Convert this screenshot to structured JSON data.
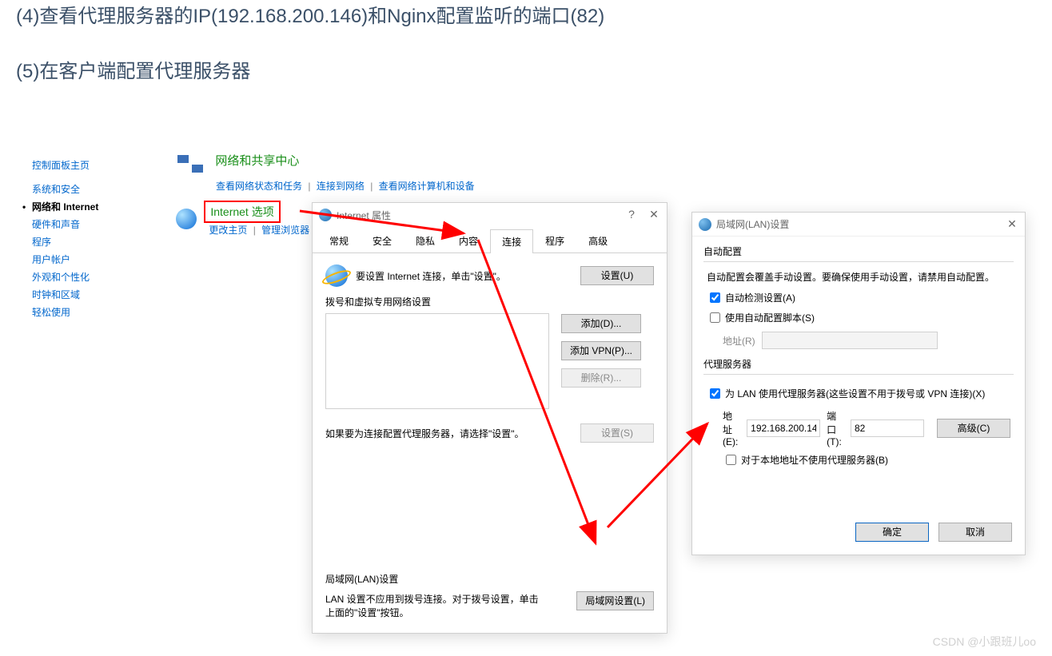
{
  "headings": {
    "line1": "(4)查看代理服务器的IP(192.168.200.146)和Nginx配置监听的端口(82)",
    "line2": "(5)在客户端配置代理服务器"
  },
  "control_panel": {
    "home": "控制面板主页",
    "sidebar": [
      "系统和安全",
      "网络和 Internet",
      "硬件和声音",
      "程序",
      "用户帐户",
      "外观和个性化",
      "时钟和区域",
      "轻松使用"
    ],
    "network_center_title": "网络和共享中心",
    "network_center_links": {
      "a": "查看网络状态和任务",
      "b": "连接到网络",
      "c": "查看网络计算机和设备"
    },
    "internet_options_label": "Internet 选项",
    "internet_options_sublinks": {
      "a": "更改主页",
      "b": "管理浏览器"
    }
  },
  "inet_dialog": {
    "title": "Internet 属性",
    "tabs": [
      "常规",
      "安全",
      "隐私",
      "内容",
      "连接",
      "程序",
      "高级"
    ],
    "instruction": "要设置 Internet 连接，单击\"设置\"。",
    "settings_btn": "设置(U)",
    "dial_legend": "拨号和虚拟专用网络设置",
    "btn_add": "添加(D)...",
    "btn_add_vpn": "添加 VPN(P)...",
    "btn_remove": "删除(R)...",
    "btn_dial_settings": "设置(S)",
    "proxy_hint": "如果要为连接配置代理服务器，请选择\"设置\"。",
    "lan_legend": "局域网(LAN)设置",
    "lan_hint": "LAN 设置不应用到拨号连接。对于拨号设置，单击上面的\"设置\"按钮。",
    "lan_btn": "局域网设置(L)"
  },
  "lan_dialog": {
    "title": "局域网(LAN)设置",
    "auto_group": "自动配置",
    "auto_hint": "自动配置会覆盖手动设置。要确保使用手动设置，请禁用自动配置。",
    "auto_detect": "自动检测设置(A)",
    "auto_script": "使用自动配置脚本(S)",
    "addr_label": "地址(R)",
    "proxy_group": "代理服务器",
    "proxy_enable": "为 LAN 使用代理服务器(这些设置不用于拨号或 VPN 连接)(X)",
    "addr2_label": "地址(E):",
    "addr2_value": "192.168.200.14",
    "port_label": "端口(T):",
    "port_value": "82",
    "adv_btn": "高级(C)",
    "bypass_local": "对于本地地址不使用代理服务器(B)",
    "ok": "确定",
    "cancel": "取消"
  },
  "watermark": "CSDN @小跟班儿oo"
}
